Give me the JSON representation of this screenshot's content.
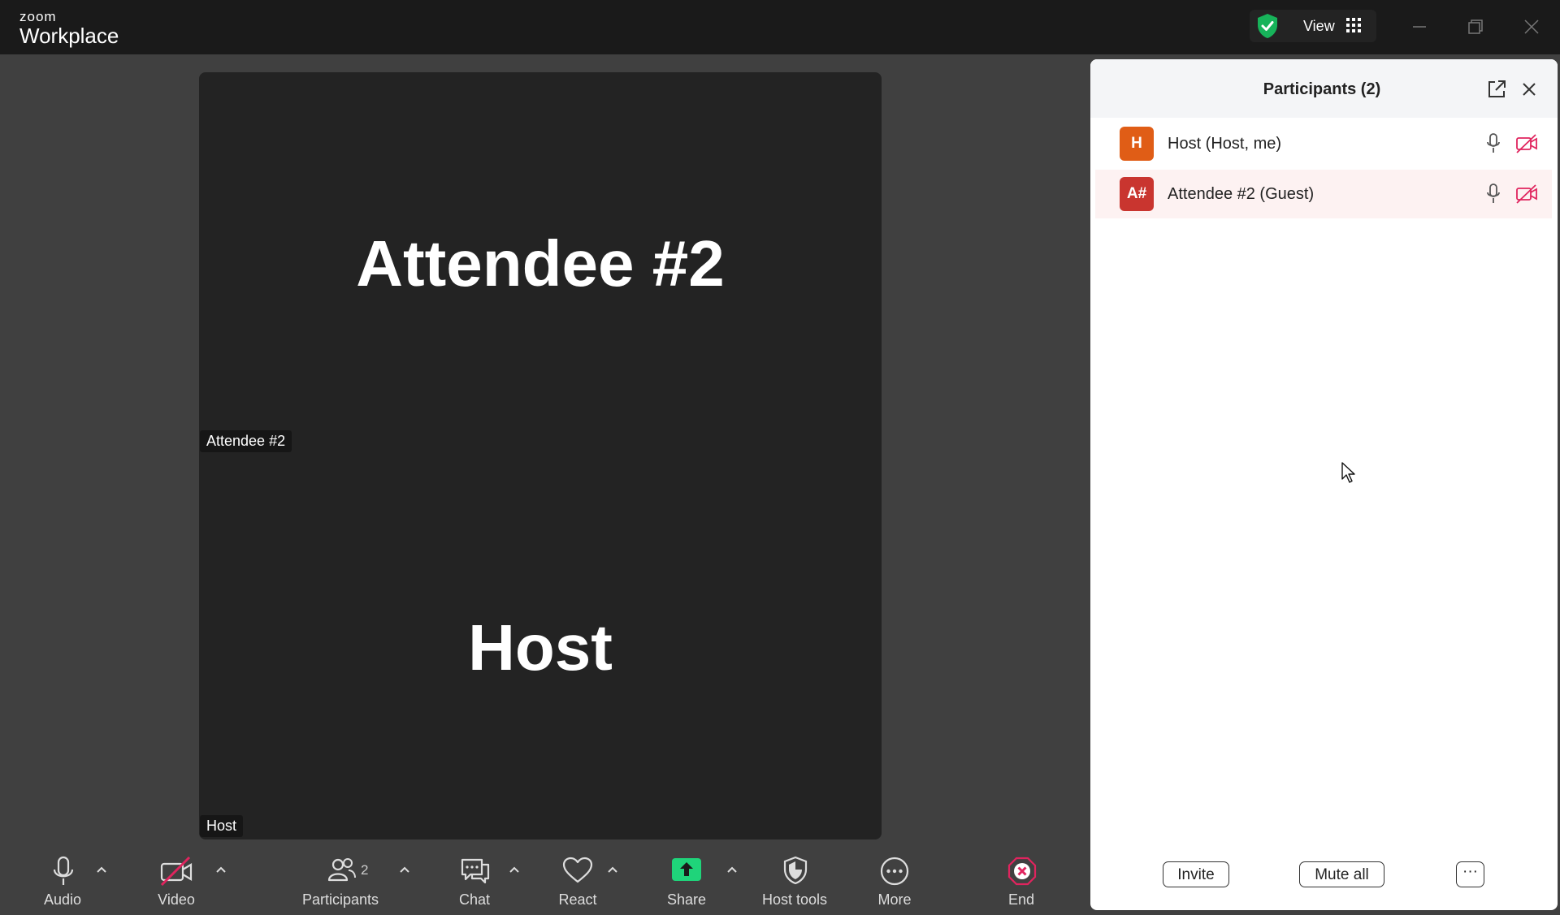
{
  "app": {
    "logo_small": "zoom",
    "logo_big": "Workplace",
    "view_label": "View"
  },
  "video": {
    "top_name": "Attendee #2",
    "bottom_name": "Host",
    "tag_top": "Attendee #2",
    "tag_bottom": "Host"
  },
  "panel": {
    "title": "Participants (2)",
    "participants": [
      {
        "initials": "H",
        "name": "Host (Host, me)",
        "color": "#e05d16"
      },
      {
        "initials": "A#",
        "name": "Attendee #2 (Guest)",
        "color": "#c9352f"
      }
    ],
    "invite_label": "Invite",
    "mute_all_label": "Mute all",
    "more_label": "···"
  },
  "toolbar": {
    "audio": "Audio",
    "video": "Video",
    "participants": "Participants",
    "participants_count": "2",
    "chat": "Chat",
    "react": "React",
    "share": "Share",
    "host_tools": "Host tools",
    "more": "More",
    "end": "End"
  },
  "colors": {
    "share_green": "#1fd47a",
    "secure_green": "#17b35a",
    "end_red": "#e0245e",
    "video_off_red": "#e0245e"
  }
}
